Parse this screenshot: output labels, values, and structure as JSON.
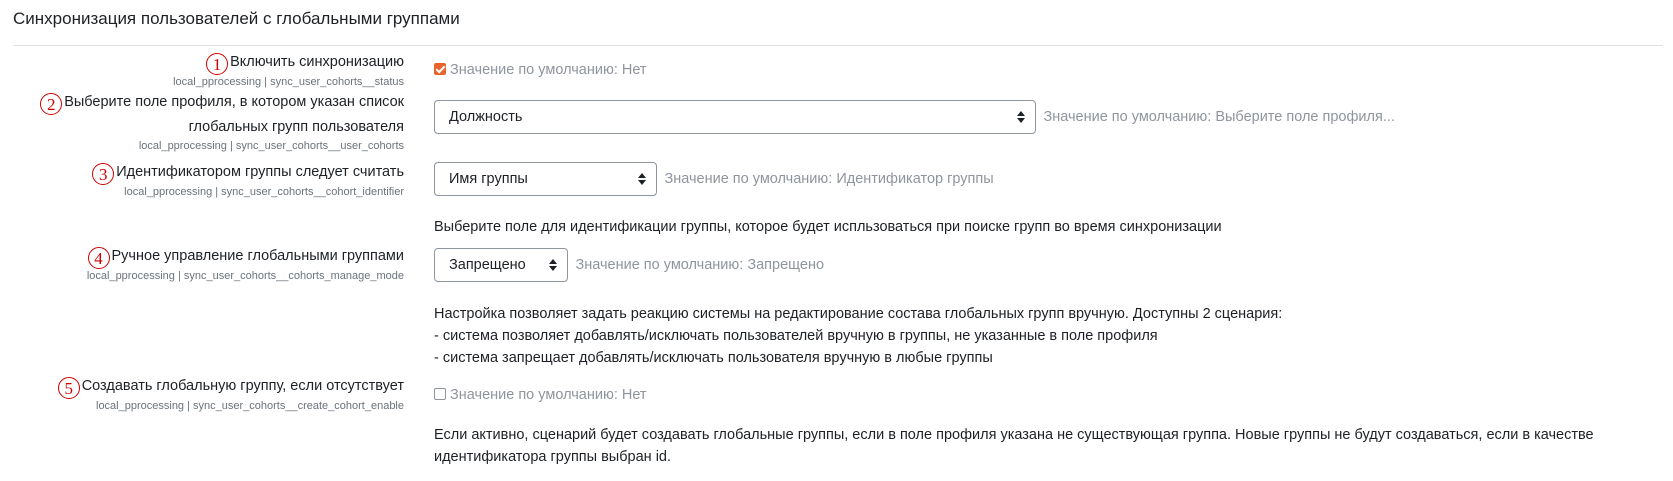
{
  "page": {
    "title": "Синхронизация пользователей с глобальными группами"
  },
  "settings": [
    {
      "number": "1",
      "label": "Включить синхронизацию",
      "key": "local_pprocessing | sync_user_cohorts__status",
      "control": {
        "type": "checkbox",
        "checked": true
      },
      "default": "Значение по умолчанию: Нет"
    },
    {
      "number": "2",
      "label_line1": "Выберите поле профиля, в котором указан список",
      "label_line2": "глобальных групп пользователя",
      "key": "local_pprocessing | sync_user_cohorts__user_cohorts",
      "control": {
        "type": "select",
        "value": "Должность"
      },
      "default": "Значение по умолчанию: Выберите поле профиля..."
    },
    {
      "number": "3",
      "label": "Идентификатором группы следует считать",
      "key": "local_pprocessing | sync_user_cohorts__cohort_identifier",
      "control": {
        "type": "select",
        "value": "Имя группы"
      },
      "default": "Значение по умолчанию: Идентификатор группы",
      "description": "Выберите поле для идентификации группы, которое будет испльзоваться при поиске групп во время синхронизации"
    },
    {
      "number": "4",
      "label": "Ручное управление глобальными группами",
      "key": "local_pprocessing | sync_user_cohorts__cohorts_manage_mode",
      "control": {
        "type": "select",
        "value": "Запрещено"
      },
      "default": "Значение по умолчанию: Запрещено",
      "description_lines": [
        "Настройка позволяет задать реакцию системы на редактирование состава глобальных групп вручную. Доступны 2 сценария:",
        "- система позволяет добавлять/исключать пользователей вручную в группы, не указанные в поле профиля",
        "- система запрещает добавлять/исключать пользователя вручную в любые группы"
      ]
    },
    {
      "number": "5",
      "label": "Создавать глобальную группу, если отсутствует",
      "key": "local_pprocessing | sync_user_cohorts__create_cohort_enable",
      "control": {
        "type": "checkbox",
        "checked": false
      },
      "default": "Значение по умолчанию: Нет",
      "description_lines": [
        "Если активно, сценарий будет создавать глобальные группы, если в поле профиля указана не существующая группа. Новые группы не будут создаваться, если в качестве",
        "идентификатора группы выбран id."
      ]
    }
  ],
  "colors": {
    "accent": "#e8642c",
    "annotation": "#d00000",
    "muted": "#8f959e"
  }
}
